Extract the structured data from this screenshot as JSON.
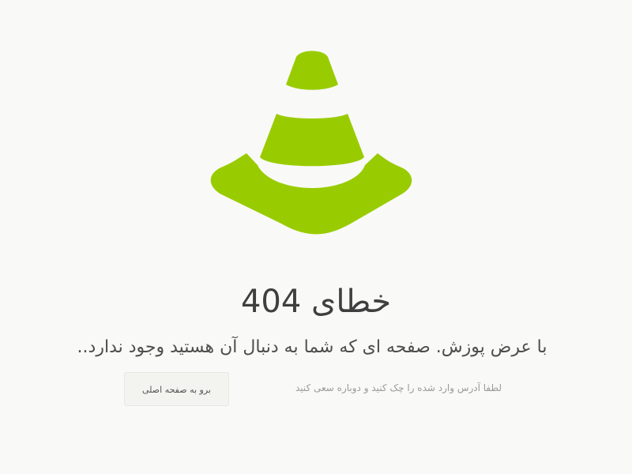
{
  "error": {
    "title": "خطای 404",
    "subtitle": "با عرض پوزش. صفحه ای که شما به دنبال آن هستید وجود ندارد..",
    "hint": "لطفا آدرس وارد شده را چک کنید و دوباره سعی کنید",
    "home_button_label": "برو به صفحه اصلی"
  },
  "illustration": {
    "icon": "traffic-cone-icon",
    "color": "#99cc00"
  },
  "colors": {
    "background": "#f9f9f8",
    "title_text": "#3f3f3f",
    "subtitle_text": "#4d4d4d",
    "hint_text": "#9a9a9a",
    "button_background": "#f3f3f0",
    "button_border": "#e7e7e4"
  }
}
